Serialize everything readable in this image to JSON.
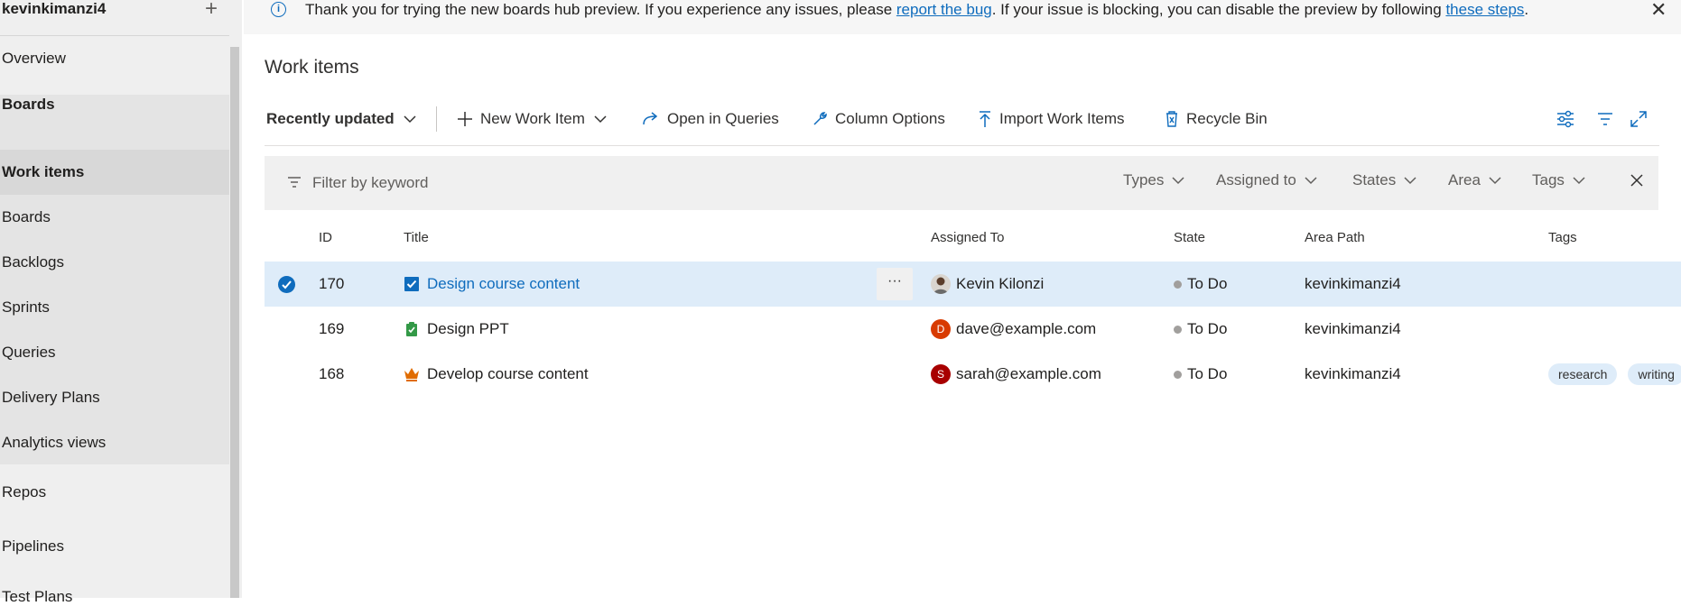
{
  "sidebar": {
    "org": "kevinkimanzi4",
    "add_label": "+",
    "items": [
      {
        "label": "Overview"
      },
      {
        "label": "Boards"
      },
      {
        "label": "Work items"
      },
      {
        "label": "Boards"
      },
      {
        "label": "Backlogs"
      },
      {
        "label": "Sprints"
      },
      {
        "label": "Queries"
      },
      {
        "label": "Delivery Plans"
      },
      {
        "label": "Analytics views"
      },
      {
        "label": "Repos"
      },
      {
        "label": "Pipelines"
      },
      {
        "label": "Test Plans"
      }
    ]
  },
  "banner": {
    "text_before": "Thank you for trying the new boards hub preview. If you experience any issues, please ",
    "link1": "report the bug",
    "text_middle": ". If your issue is blocking, you can disable the preview by following ",
    "link2": "these steps",
    "text_after": ".",
    "close_label": "✕"
  },
  "page": {
    "title": "Work items"
  },
  "toolbar": {
    "view": "Recently updated",
    "new_item": "New Work Item",
    "open_queries": "Open in Queries",
    "column_options": "Column Options",
    "import": "Import Work Items",
    "recycle": "Recycle Bin"
  },
  "filter": {
    "placeholder": "Filter by keyword",
    "types": "Types",
    "assigned": "Assigned to",
    "states": "States",
    "area": "Area",
    "tags": "Tags"
  },
  "table": {
    "headers": {
      "id": "ID",
      "title": "Title",
      "assigned": "Assigned To",
      "state": "State",
      "area": "Area Path",
      "tags": "Tags"
    },
    "more_label": "···",
    "rows": [
      {
        "id": "170",
        "title": "Design course content",
        "type_icon": "task-icon",
        "assigned": "Kevin Kilonzi",
        "avatar_letter": "",
        "state": "To Do",
        "area": "kevinkimanzi4",
        "tags": []
      },
      {
        "id": "169",
        "title": "Design PPT",
        "type_icon": "backlog-item-icon",
        "assigned": "dave@example.com",
        "avatar_letter": "D",
        "state": "To Do",
        "area": "kevinkimanzi4",
        "tags": []
      },
      {
        "id": "168",
        "title": "Develop course content",
        "type_icon": "epic-icon",
        "assigned": "sarah@example.com",
        "avatar_letter": "S",
        "state": "To Do",
        "area": "kevinkimanzi4",
        "tags": [
          "research",
          "writing"
        ]
      }
    ]
  },
  "colors": {
    "accent": "#0f6cbd",
    "selected_row": "#deecf9",
    "task": "#0f6cbd",
    "backlog_item": "#339947",
    "epic": "#e06c00",
    "avatar_dave": "#d83b01",
    "avatar_sarah": "#a80000"
  }
}
